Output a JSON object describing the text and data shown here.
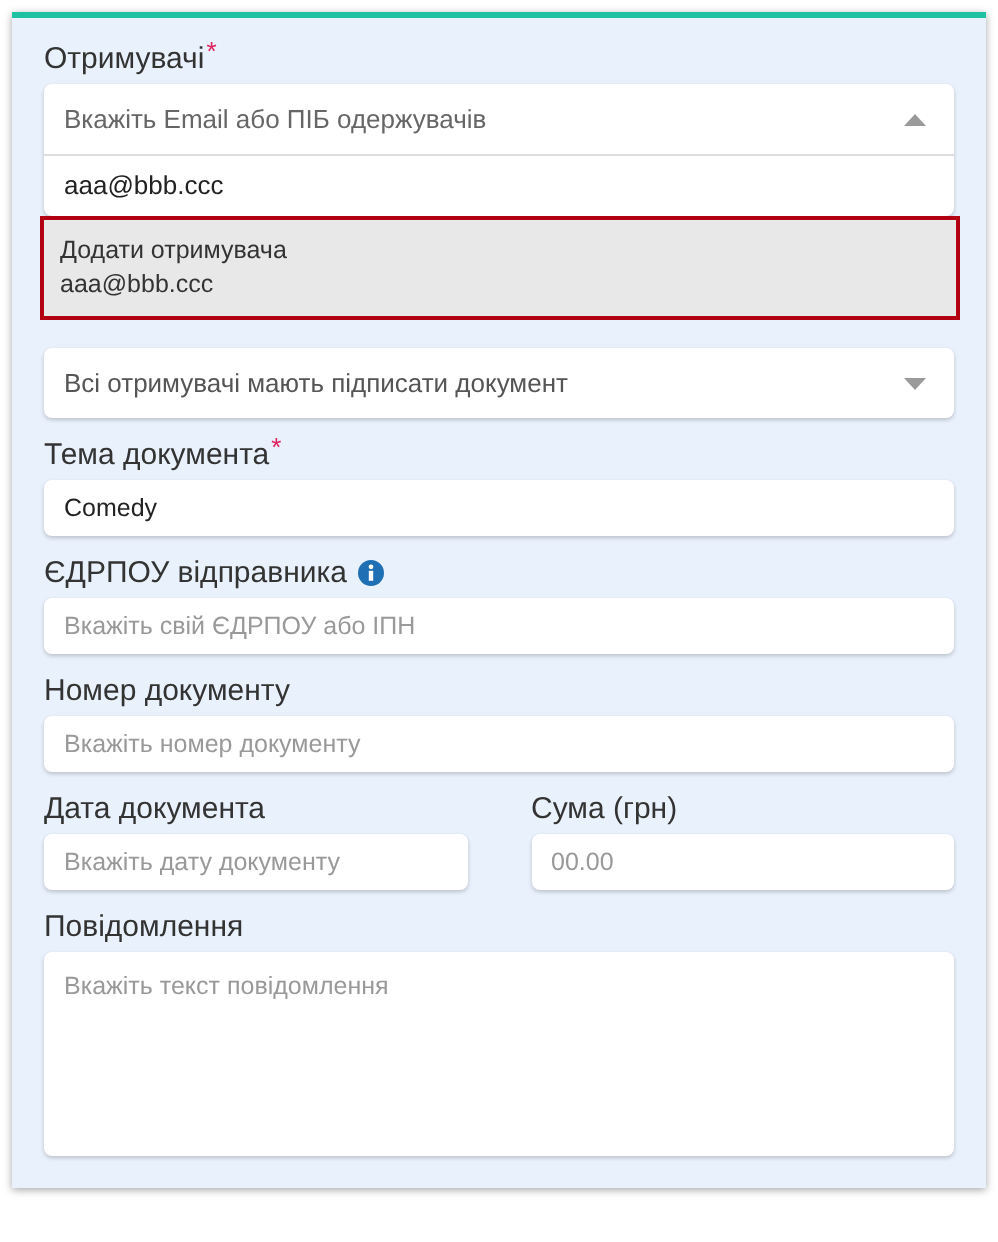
{
  "recipients": {
    "label": "Отримувачі",
    "mark": "*",
    "placeholder": "Вкажіть Email або ПІБ одержувачів",
    "expanded": true,
    "search_value": "aaa@bbb.ccc",
    "options": [
      {
        "label": "Додати отримувача",
        "detail": "aaa@bbb.ccc",
        "selected": true
      }
    ]
  },
  "processing_rule": {
    "value": "Всі отримувачі мають підписати документ"
  },
  "fields": [
    {
      "kind": "text",
      "label": "Тема документа",
      "mark": "*",
      "value": "Comedy"
    },
    {
      "kind": "text",
      "label": "ЄДРПОУ відправника",
      "info": true,
      "placeholder": "Вкажіть свій ЄДРПОУ або ІПН"
    },
    {
      "kind": "text",
      "label": "Номер документу",
      "placeholder": "Вкажіть номер документу"
    },
    {
      "kind": "half",
      "label": "Дата документа",
      "placeholder": "Вкажіть дату документу"
    },
    {
      "kind": "half",
      "label": "Сума (грн)",
      "placeholder": "00.00"
    },
    {
      "kind": "textarea",
      "label": "Повідомлення",
      "placeholder": "Вкажіть текст повідомлення"
    }
  ]
}
